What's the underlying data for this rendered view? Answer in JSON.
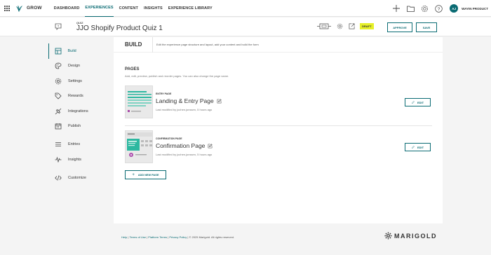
{
  "brand": {
    "name": "GROW",
    "accent": "#0a6b73"
  },
  "nav": {
    "items": [
      {
        "label": "DASHBOARD",
        "active": false
      },
      {
        "label": "EXPERIENCES",
        "active": true
      },
      {
        "label": "CONTENT",
        "active": false
      },
      {
        "label": "INSIGHTS",
        "active": false
      },
      {
        "label": "EXPERIENCE LIBRARY",
        "active": false
      }
    ],
    "icons": [
      "plus-icon",
      "folder-icon",
      "gear-icon",
      "help-icon"
    ],
    "user": {
      "initials": "AJ",
      "name": "WAYIN PRODUCT"
    }
  },
  "header": {
    "type_label": "QUIZ",
    "title": "JJO Shopify Product Quiz 1",
    "status": "DRAFT",
    "approve_label": "APPROVE",
    "save_label": "SAVE",
    "status_color": "#e6f029"
  },
  "sidebar": {
    "items": [
      {
        "label": "Build",
        "icon": "build-icon",
        "active": true
      },
      {
        "label": "Design",
        "icon": "palette-icon"
      },
      {
        "label": "Settings",
        "icon": "gear-icon"
      },
      {
        "label": "Rewards",
        "icon": "tag-icon"
      },
      {
        "label": "Integrations",
        "icon": "plug-icon"
      },
      {
        "label": "Publish",
        "icon": "calendar-icon"
      },
      {
        "label": "Entries",
        "icon": "list-icon"
      },
      {
        "label": "Insights",
        "icon": "pulse-icon"
      },
      {
        "label": "Customize",
        "icon": "code-icon"
      }
    ]
  },
  "main": {
    "title": "BUILD",
    "description": "Edit the experience page structure and layout, add your content and build the form",
    "pages_title": "PAGES",
    "pages_description": "Add, edit, preview, publish and reorder pages. You can also change the page name.",
    "pages": [
      {
        "type": "ENTRY PAGE",
        "name": "Landing & Entry Page",
        "modified": "Last modified by jochen.jonssen, 5 hours ago",
        "edit_label": "EDIT"
      },
      {
        "type": "CONFIRMATION PAGE",
        "name": "Confirmation Page",
        "modified": "Last modified by jochen.jonssen, 5 hours ago",
        "edit_label": "EDIT"
      }
    ],
    "add_page_label": "ADD NEW PAGE"
  },
  "footer": {
    "links": [
      "Help",
      "Terms of Use",
      "Platform Terms",
      "Privacy Policy"
    ],
    "copyright": "© 2025 Marigold. All rights reserved.",
    "logo_text": "MARIGOLD"
  }
}
